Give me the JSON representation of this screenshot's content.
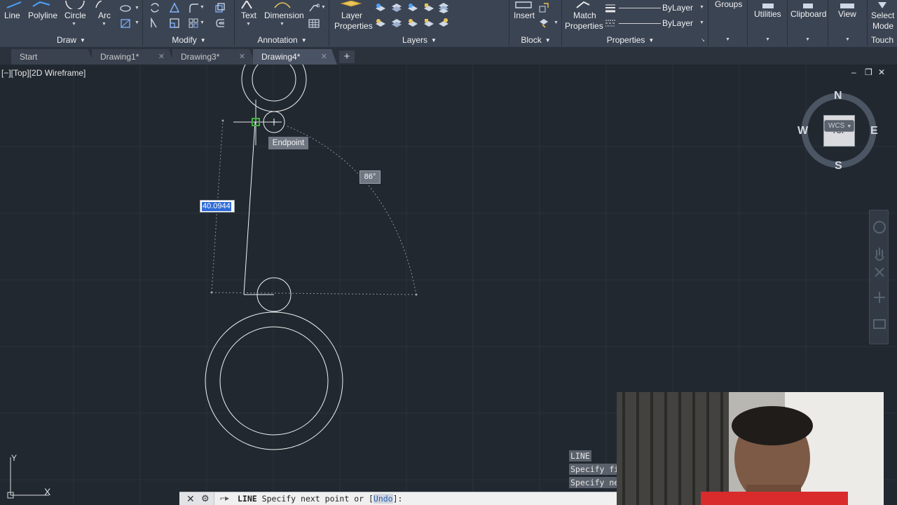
{
  "ribbon": {
    "draw": {
      "title": "Draw",
      "buttons": [
        "Line",
        "Polyline",
        "Circle",
        "Arc"
      ]
    },
    "modify": {
      "title": "Modify"
    },
    "annotation": {
      "title": "Annotation",
      "buttons": [
        "Text",
        "Dimension"
      ]
    },
    "layers": {
      "title": "Layers",
      "buttons": [
        "Layer",
        "Properties"
      ]
    },
    "block": {
      "title": "Block",
      "insert": "Insert"
    },
    "properties": {
      "title": "Properties",
      "match": [
        "Match",
        "Properties"
      ],
      "bylayer": [
        "ByLayer",
        "ByLayer"
      ]
    },
    "groups": "Groups",
    "utilities": "Utilities",
    "clipboard": "Clipboard",
    "view": "View",
    "touch": {
      "select_mode": [
        "Select",
        "Mode"
      ],
      "title": "Touch"
    }
  },
  "tabs": [
    {
      "label": "Start"
    },
    {
      "label": "Drawing1*"
    },
    {
      "label": "Drawing3*"
    },
    {
      "label": "Drawing4*",
      "active": true
    }
  ],
  "viewport": {
    "label": "[−][Top][2D Wireframe]",
    "snap_tooltip": "Endpoint",
    "angle": "86°",
    "distance_input": "40.0944",
    "window_controls": [
      "–",
      "❒",
      "✕"
    ]
  },
  "viewcube": {
    "north": "N",
    "south": "S",
    "east": "E",
    "west": "W",
    "face": "TOP",
    "wcs": "WCS"
  },
  "ucs": {
    "y": "Y",
    "x": "X"
  },
  "command_history": [
    "LINE",
    "Specify fi",
    "Specify ne"
  ],
  "command_line": {
    "command": "LINE",
    "prompt": "Specify next point or [",
    "option": "Undo",
    "suffix": "]:"
  },
  "colors": {
    "canvas": "#212830",
    "ribbon": "#3b4453",
    "selection": "#2f6bd6",
    "snap_marker": "#3fb33f"
  }
}
